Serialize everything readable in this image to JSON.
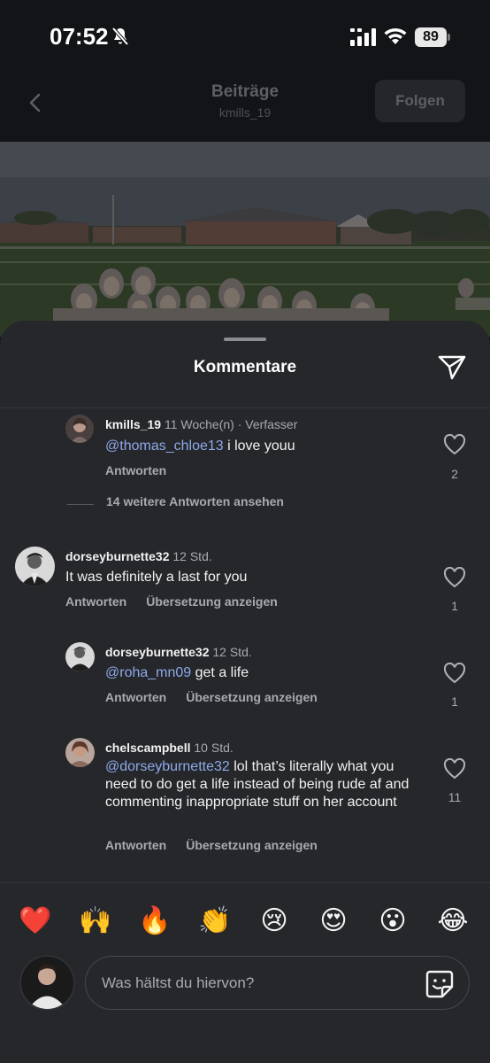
{
  "status_bar": {
    "time": "07:52",
    "battery": "89"
  },
  "header": {
    "title": "Beiträge",
    "subtitle": "kmills_19",
    "follow_label": "Folgen"
  },
  "sheet": {
    "title": "Kommentare"
  },
  "comments": [
    {
      "username": "kmills_19",
      "meta": "11 Woche(n) · Verfasser",
      "mention": "@thomas_chloe13",
      "text": " i love youu",
      "reply_label": "Antworten",
      "likes": "2",
      "avatar_color": "#8a6f66"
    },
    {
      "username": "dorseyburnette32",
      "meta": "12 Std.",
      "mention": "",
      "text": "It was definitely a last for you",
      "reply_label": "Antworten",
      "translate_label": "Übersetzung anzeigen",
      "likes": "1",
      "avatar_color": "#9a9a9a"
    },
    {
      "username": "dorseyburnette32",
      "meta": "12 Std.",
      "mention": "@roha_mn09",
      "text": " get a life",
      "reply_label": "Antworten",
      "translate_label": "Übersetzung anzeigen",
      "likes": "1",
      "avatar_color": "#9a9a9a"
    },
    {
      "username": "chelscampbell",
      "meta": "10 Std.",
      "mention": "@dorseyburnette32",
      "text": " lol that’s literally what you need to do get a life instead of being rude af and commenting inappropriate stuff on her account",
      "reply_label": "Antworten",
      "translate_label": "Übersetzung anzeigen",
      "likes": "11",
      "avatar_color": "#b08a7c"
    }
  ],
  "more_replies": "14 weitere Antworten ansehen",
  "reactions": [
    "❤️",
    "🙌",
    "🔥",
    "👏",
    "😢",
    "😍",
    "😮",
    "😂"
  ],
  "composer": {
    "placeholder": "Was hältst du hiervon?"
  }
}
